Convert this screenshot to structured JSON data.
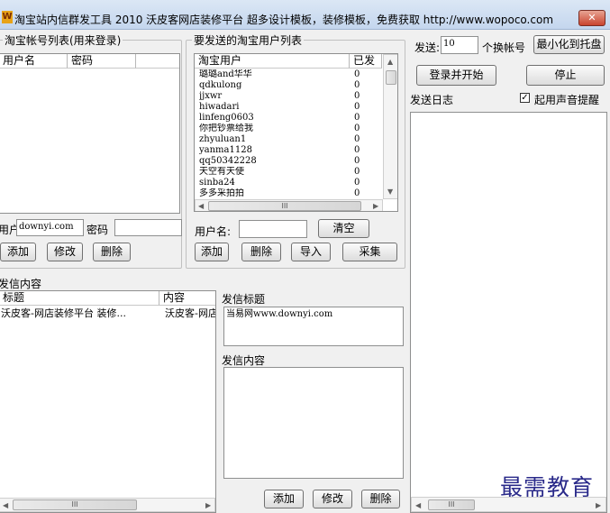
{
  "window": {
    "title": "淘宝站内信群发工具 2010  沃皮客网店装修平台  超多设计模板，装修模板，免费获取 http://www.wopoco.com",
    "close": "✕",
    "app_icon": "W"
  },
  "accounts": {
    "legend": "淘宝帐号列表(用来登录)",
    "col_user": "用户名",
    "col_pass": "密码",
    "user_label": "用户",
    "user_value": "downyi.com",
    "pass_label": "密码",
    "add": "添加",
    "edit": "修改",
    "delete": "删除"
  },
  "targets": {
    "legend": "要发送的淘宝用户列表",
    "col_user": "淘宝用户",
    "col_sent": "已发",
    "rows": [
      {
        "user": "璐璐and华华",
        "sent": "0"
      },
      {
        "user": "qdkulong",
        "sent": "0"
      },
      {
        "user": "jjxwr",
        "sent": "0"
      },
      {
        "user": "hiwadari",
        "sent": "0"
      },
      {
        "user": "linfeng0603",
        "sent": "0"
      },
      {
        "user": "你把钞票给我",
        "sent": "0"
      },
      {
        "user": "zhyuluan1",
        "sent": "0"
      },
      {
        "user": "yanma1128",
        "sent": "0"
      },
      {
        "user": "qq50342228",
        "sent": "0"
      },
      {
        "user": "天空有天使",
        "sent": "0"
      },
      {
        "user": "sinba24",
        "sent": "0"
      },
      {
        "user": "多多采拍拍",
        "sent": "0"
      }
    ],
    "username_label": "用户名:",
    "clear": "清空",
    "add": "添加",
    "delete": "删除",
    "import": "导入",
    "collect": "采集",
    "hscroll_glyph": "III"
  },
  "send": {
    "send_label": "发送:",
    "send_value": "10",
    "switch_label": "个换帐号",
    "minimize_tray": "最小化到托盘",
    "login_start": "登录并开始",
    "stop": "停止",
    "log_label": "发送日志",
    "sound_checked": true,
    "sound_label": "起用声音提醒",
    "check_mark": "✓"
  },
  "messages": {
    "legend": "发信内容",
    "col_title": "标题",
    "col_content": "内容",
    "rows": [
      {
        "title": "沃皮客-网店装修平台  装修...",
        "content": "沃皮客-网店"
      }
    ],
    "subject_label": "发信标题",
    "subject_value": "当易网www.downyi.com",
    "content_label": "发信内容",
    "add": "添加",
    "edit": "修改",
    "delete": "删除",
    "hscroll_glyph": "III"
  },
  "watermark": "最需教育"
}
